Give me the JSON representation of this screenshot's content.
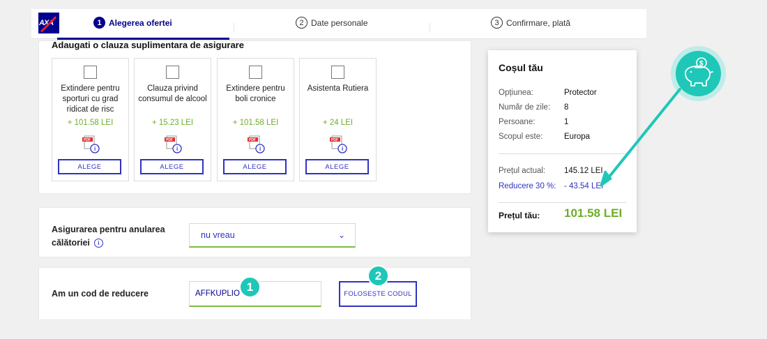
{
  "header": {
    "logo_text": "AXA",
    "steps": [
      {
        "num": "1",
        "label": "Alegerea ofertei"
      },
      {
        "num": "2",
        "label": "Date personale"
      },
      {
        "num": "3",
        "label": "Confirmare, plată"
      }
    ]
  },
  "clauses": {
    "title": "Adaugati o clauza suplimentara de asigurare",
    "cards": [
      {
        "title": "Extindere pentru sporturi cu grad ridicat de risc",
        "price": "+ 101.58 LEI",
        "button": "ALEGE"
      },
      {
        "title": "Clauza privind consumul de alcool",
        "price": "+ 15.23 LEI",
        "button": "ALEGE"
      },
      {
        "title": "Extindere pentru boli cronice",
        "price": "+ 101.58 LEI",
        "button": "ALEGE"
      },
      {
        "title": "Asistenta Rutiera",
        "price": "+ 24 LEI",
        "button": "ALEGE"
      }
    ]
  },
  "cancellation": {
    "label": "Asigurarea pentru anularea călătoriei",
    "info_icon": "i",
    "select_value": "nu vreau"
  },
  "discount": {
    "label": "Am un cod de reducere",
    "code_value": "AFFKUPLIO",
    "button": "FOLOSEȘTE CODUL",
    "badge1": "1",
    "badge2": "2"
  },
  "cart": {
    "title": "Coșul tău",
    "rows": [
      {
        "label": "Opțiunea:",
        "value": "Protector"
      },
      {
        "label": "Număr de zile:",
        "value": "8"
      },
      {
        "label": "Persoane:",
        "value": "1"
      },
      {
        "label": "Scopul este:",
        "value": "Europa"
      }
    ],
    "current_price_label": "Prețul actual:",
    "current_price": "145.12 LEI",
    "discount_label": "Reducere  30 %:",
    "discount_value": "- 43.54 LEI",
    "total_label": "Prețul tău:",
    "total_value": "101.58 LEI"
  },
  "colors": {
    "brand": "#00008f",
    "accent_button": "#3032c1",
    "price_green": "#6cae2a",
    "teal": "#1fc7b8"
  },
  "icons": [
    "axa-logo",
    "pdf-icon",
    "info-icon",
    "chevron-down-icon",
    "piggy-bank-icon",
    "arrow-icon"
  ]
}
